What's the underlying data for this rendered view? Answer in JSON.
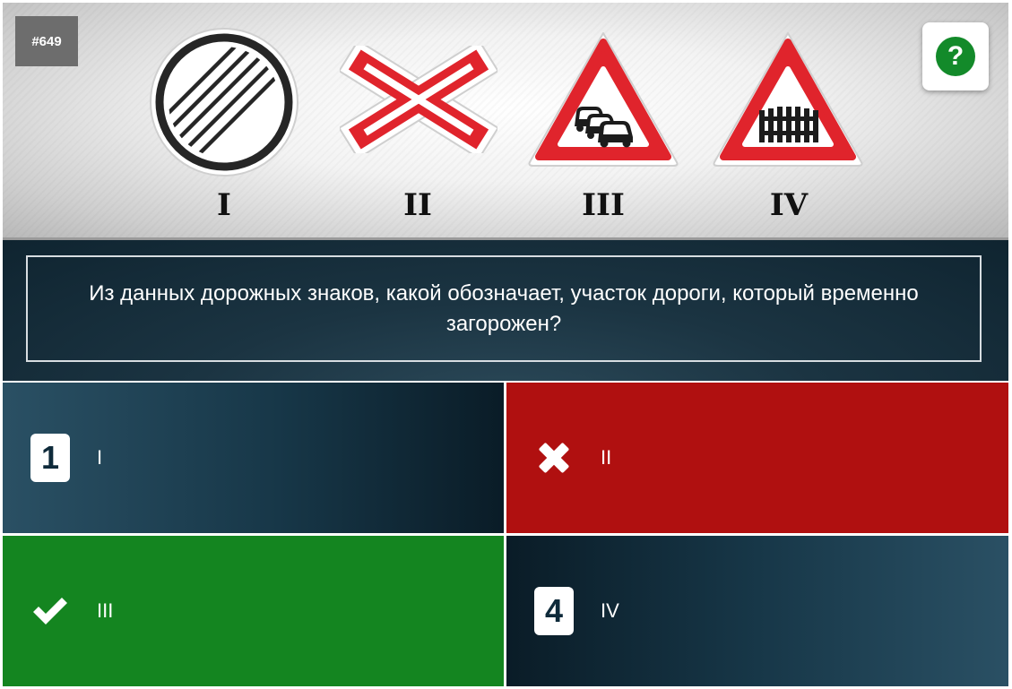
{
  "question_number": "#649",
  "help": {
    "icon": "help-icon",
    "symbol": "?"
  },
  "signs": [
    {
      "label": "I",
      "icon": "end-of-all-restrictions-sign-icon"
    },
    {
      "label": "II",
      "icon": "single-track-railway-crossing-sign-icon"
    },
    {
      "label": "III",
      "icon": "traffic-queue-sign-icon"
    },
    {
      "label": "IV",
      "icon": "railway-crossing-with-barrier-sign-icon"
    }
  ],
  "question": "Из данных дорожных знаков, какой обозначает, участок дороги, который временно загорожен?",
  "answers": [
    {
      "marker": "1",
      "text": "I",
      "state": "neutral"
    },
    {
      "marker": "",
      "text": "II",
      "state": "wrong",
      "icon": "cross-icon"
    },
    {
      "marker": "",
      "text": "III",
      "state": "correct",
      "icon": "check-icon"
    },
    {
      "marker": "4",
      "text": "IV",
      "state": "neutral"
    }
  ],
  "colors": {
    "wrong": "#b01010",
    "correct": "#148520",
    "help_green": "#138a2a",
    "sign_red": "#e0242c"
  }
}
